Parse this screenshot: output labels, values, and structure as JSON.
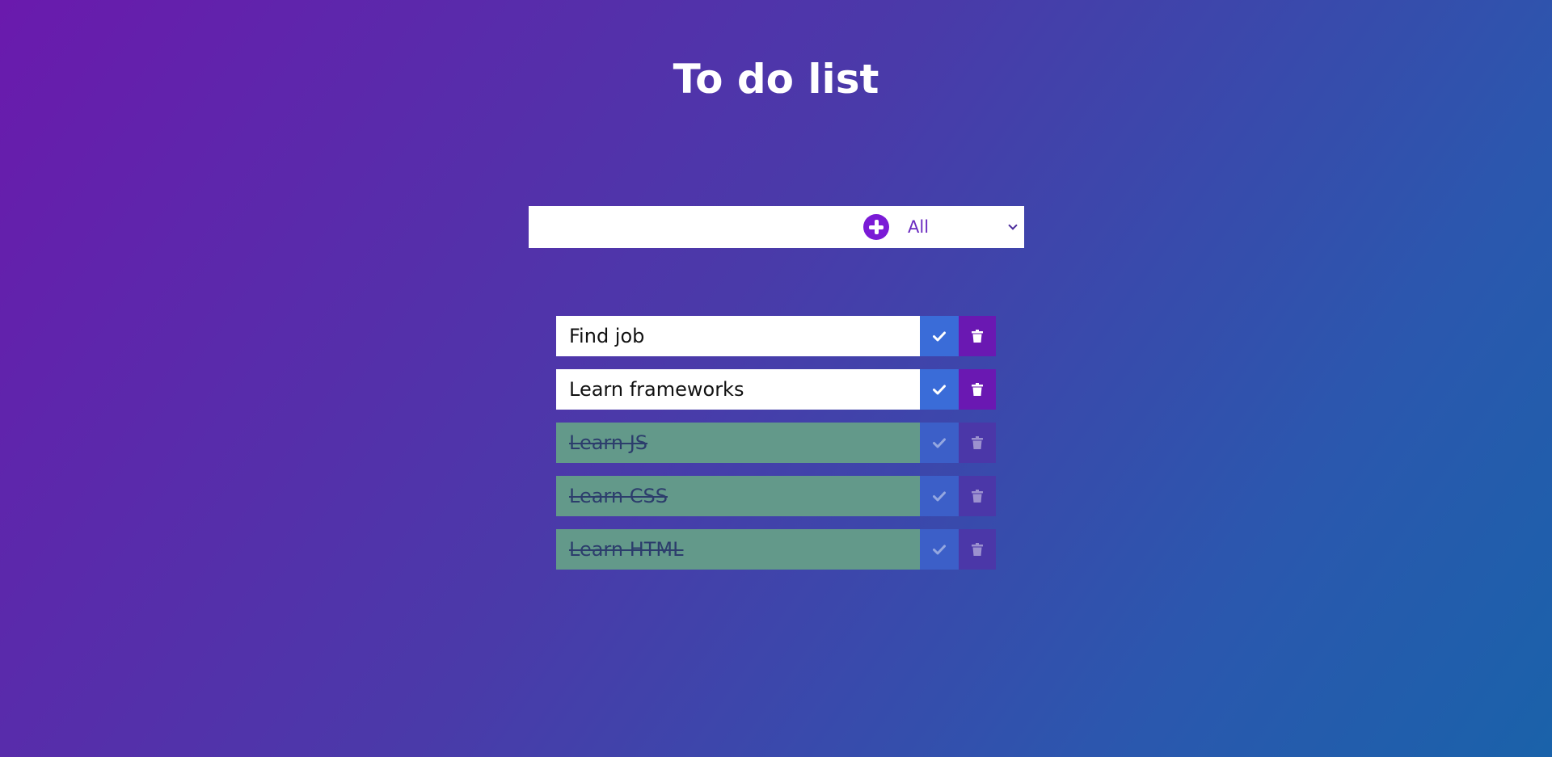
{
  "header": {
    "title": "To do list"
  },
  "form": {
    "input_value": "",
    "input_placeholder": "",
    "add_icon": "plus-circle-icon",
    "filter_selected": "All"
  },
  "todos": [
    {
      "text": "Find job",
      "completed": false
    },
    {
      "text": "Learn frameworks",
      "completed": false
    },
    {
      "text": "Learn JS",
      "completed": true
    },
    {
      "text": "Learn CSS",
      "completed": true
    },
    {
      "text": "Learn HTML",
      "completed": true
    }
  ],
  "icons": {
    "complete": "check-icon",
    "delete": "trash-icon"
  },
  "colors": {
    "accent": "#7a1ad6",
    "complete_button": "#3a6cd8",
    "delete_button": "#6a18b2",
    "completed_item": "#63998a"
  }
}
